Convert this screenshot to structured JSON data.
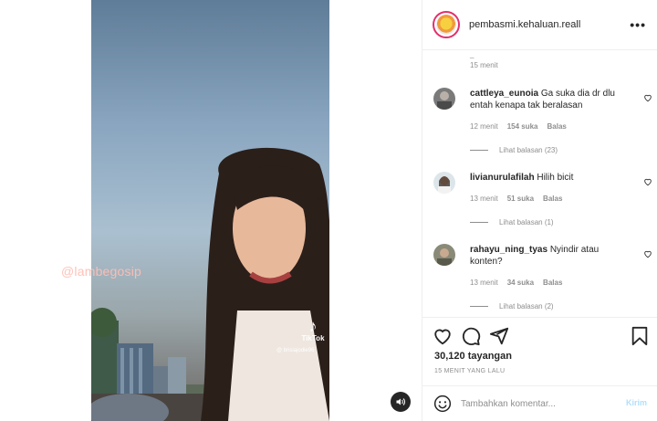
{
  "media": {
    "watermark": "@lambegosip",
    "tiktok_label": "TikTok",
    "tiktok_user": "@ brisiajodie96"
  },
  "post": {
    "username": "pembasmi.kehaluan.reall",
    "views": "30,120 tayangan",
    "posted_ago": "15 MENIT YANG LALU"
  },
  "comments_top": {
    "stub": "_",
    "time": "15 menit"
  },
  "comments": [
    {
      "username": "cattleya_eunoia",
      "text": "Ga suka dia dr dlu entah kenapa tak beralasan",
      "time": "12 menit",
      "likes": "154 suka",
      "reply": "Balas",
      "view_replies": "Lihat balasan (23)"
    },
    {
      "username": "livianurulafilah",
      "text": "Hilih bicit",
      "time": "13 menit",
      "likes": "51 suka",
      "reply": "Balas",
      "view_replies": "Lihat balasan (1)"
    },
    {
      "username": "rahayu_ning_tyas",
      "text": "Nyindir atau konten?",
      "time": "13 menit",
      "likes": "34 suka",
      "reply": "Balas",
      "view_replies": "Lihat balasan (2)"
    }
  ],
  "add_comment": {
    "placeholder": "Tambahkan komentar...",
    "post_label": "Kirim"
  },
  "colors": {
    "accent_post_disabled": "#b2dffc",
    "secondary_text": "#8e8e8e",
    "primary_text": "#262626"
  }
}
